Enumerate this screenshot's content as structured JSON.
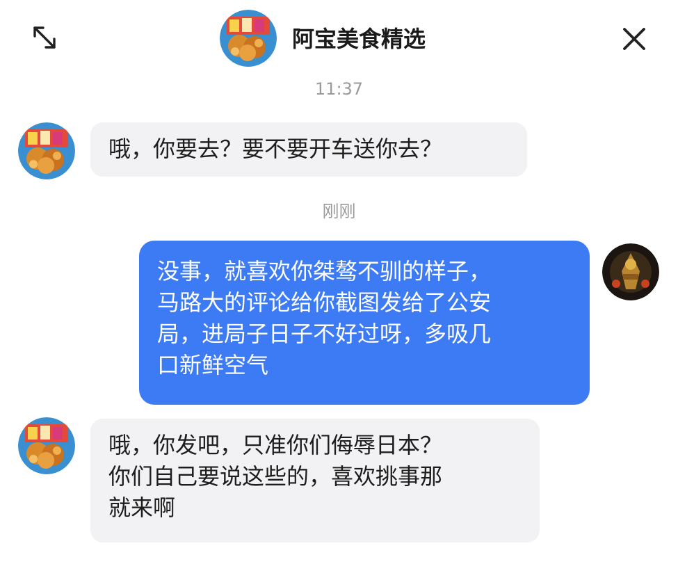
{
  "header": {
    "title": "阿宝美食精选",
    "expand_icon": "expand-arrows-icon",
    "close_icon": "close-icon"
  },
  "messages": {
    "time_1": "11:37",
    "msg_1": "哦，你要去？要不要开车送你去？",
    "time_2": "刚刚",
    "msg_2_lines": [
      "没事，就喜欢你桀骜不驯的样子，",
      "马路大的评论给你截图发给了公安",
      "局，进局子日子不好过呀，多吸几",
      "口新鲜空气"
    ],
    "msg_3_lines": [
      "哦，你发吧，只准你们侮辱日本？",
      "你们自己要说这些的，喜欢挑事那",
      "就来啊"
    ]
  },
  "colors": {
    "outgoing_bubble": "#3d7bf5",
    "incoming_bubble": "#f2f2f4",
    "timestamp": "#9a9a9a"
  }
}
